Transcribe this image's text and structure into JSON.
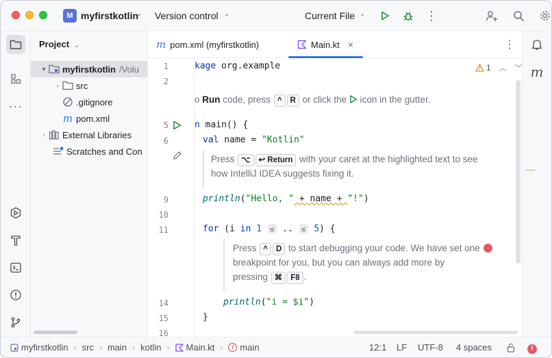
{
  "titlebar": {
    "project_badge": "M",
    "project_name": "myfirstkotlin",
    "version_control": "Version control",
    "run_config": "Current File"
  },
  "project_panel": {
    "title": "Project",
    "tree": [
      {
        "label": "myfirstkotlin",
        "suffix": "/Volu",
        "icon": "module-folder-icon"
      },
      {
        "label": "src",
        "icon": "folder-icon"
      },
      {
        "label": ".gitignore",
        "icon": "ignore-file-icon"
      },
      {
        "label": "pom.xml",
        "icon": "maven-icon"
      },
      {
        "label": "External Libraries",
        "icon": "library-icon"
      },
      {
        "label": "Scratches and Con",
        "icon": "scratches-icon"
      }
    ]
  },
  "tabs": [
    {
      "label": "pom.xml (myfirstkotlin)",
      "icon": "maven-icon"
    },
    {
      "label": "Main.kt",
      "icon": "kotlin-icon",
      "active": true
    }
  ],
  "editor": {
    "warning_count": "1",
    "line_numbers": [
      "1",
      "2",
      "5",
      "6",
      "9",
      "10",
      "11",
      "14",
      "15",
      "16"
    ],
    "line1_a": "kage",
    "line1_b": " org.example",
    "doc1": {
      "pre": "o ",
      "run": "Run",
      "mid1": " code, press ",
      "key1": "^",
      "key2": "R",
      "mid2": " or click the ",
      "post": " icon in the gutter."
    },
    "line5_a": "n",
    "line5_b": " main() {",
    "line6_kw": "val",
    "line6_b": " name = ",
    "line6_str": "\"Kotlin\"",
    "doc2": {
      "pre": "Press ",
      "key1": "⌥",
      "key2": "↩ Return",
      "post": " with your caret at the highlighted text to see",
      "line2": "how IntelliJ IDEA suggests fixing it."
    },
    "line9_fn": "println",
    "line9_a": "(",
    "line9_str1": "\"Hello, \"",
    "line9_b": " + name + ",
    "line9_str2": "\"!\"",
    "line9_c": ")",
    "line11_kw1": "for",
    "line11_a": " (i ",
    "line11_kw2": "in",
    "line11_num1": "1",
    "line11_hint1": "≤",
    "line11_dots": "..",
    "line11_hint2": "≤",
    "line11_num2": "5",
    "line11_b": ") {",
    "doc3": {
      "pre": "Press ",
      "key1": "^",
      "key2": "D",
      "post": " to start debugging your code. We have set one",
      "line2": "breakpoint for you, but you can always add more by",
      "line3_pre": "pressing ",
      "key3": "⌘",
      "key4": "F8",
      "line3_post": "."
    },
    "line14_fn": "println",
    "line14_a": "(",
    "line14_str": "\"i = $i\"",
    "line14_b": ")",
    "line15": "}"
  },
  "statusbar": {
    "breadcrumbs": [
      "myfirstkotlin",
      "src",
      "main",
      "kotlin",
      "Main.kt",
      "main"
    ],
    "position": "12:1",
    "line_sep": "LF",
    "encoding": "UTF-8",
    "indent": "4 spaces"
  },
  "colors": {
    "accent": "#3574f0",
    "run_green": "#208a3c",
    "breakpoint": "#e55765"
  }
}
